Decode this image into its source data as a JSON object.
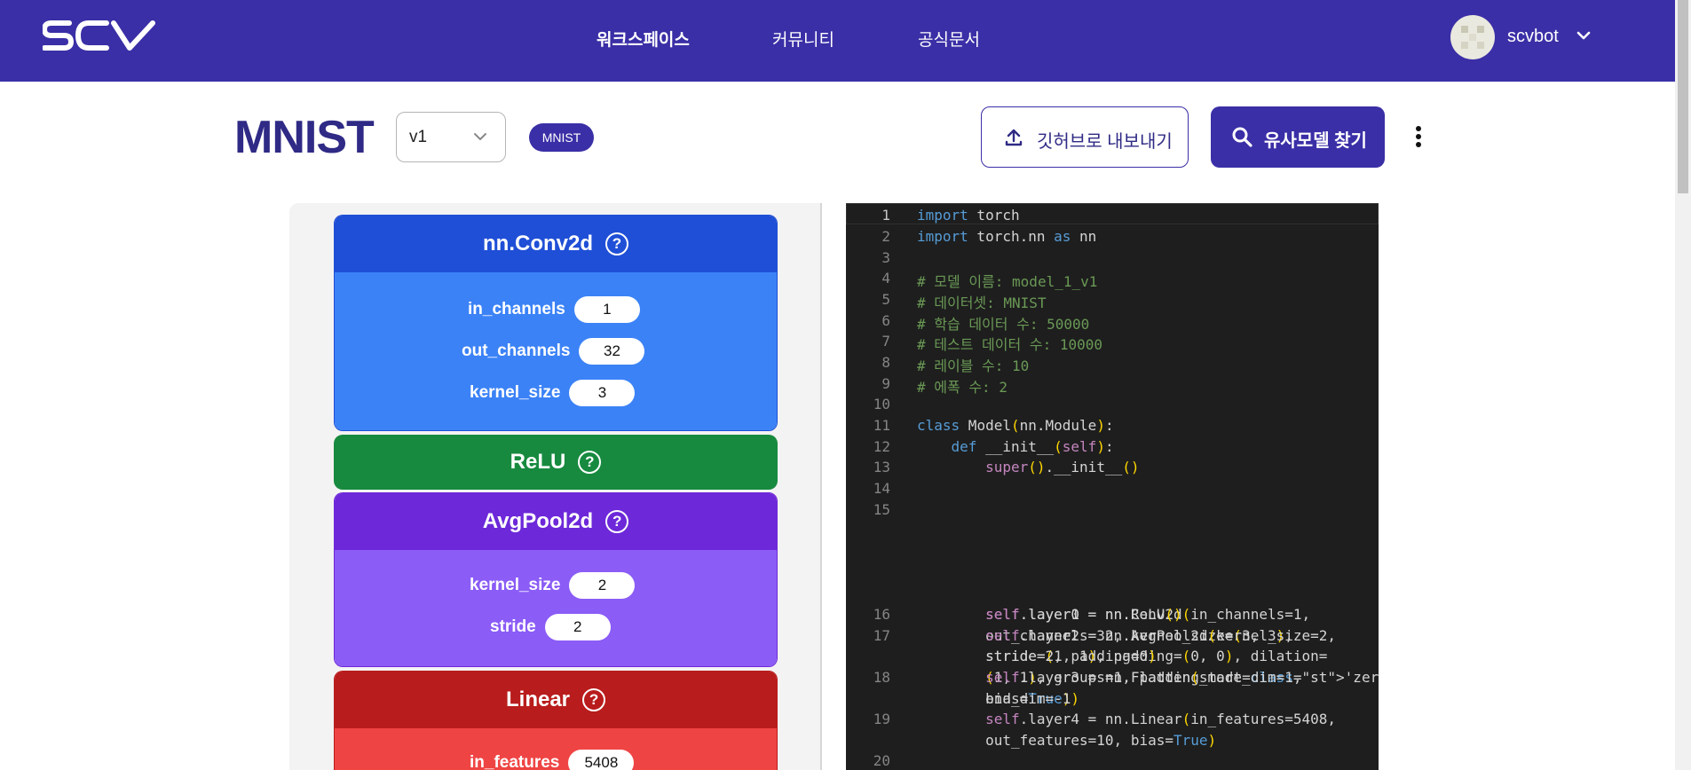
{
  "header": {
    "logo_text": "SCV",
    "nav": [
      "워크스페이스",
      "커뮤니티",
      "공식문서"
    ],
    "active_nav": "워크스페이스",
    "username": "scvbot"
  },
  "model": {
    "title": "MNIST",
    "version": "v1",
    "dataset_badge": "MNIST"
  },
  "actions": {
    "export_label": "깃허브로 내보내기",
    "find_label": "유사모델 찾기"
  },
  "layers": [
    {
      "name": "nn.Conv2d",
      "color": "#1f4fd6",
      "body_color": "#3b82f6",
      "params": [
        {
          "label": "in_channels",
          "value": "1"
        },
        {
          "label": "out_channels",
          "value": "32"
        },
        {
          "label": "kernel_size",
          "value": "3"
        }
      ]
    },
    {
      "name": "ReLU",
      "color": "#178a3f",
      "params": []
    },
    {
      "name": "AvgPool2d",
      "color": "#6d28d9",
      "body_color": "#8b5cf6",
      "params": [
        {
          "label": "kernel_size",
          "value": "2"
        },
        {
          "label": "stride",
          "value": "2"
        }
      ]
    },
    {
      "name": "Linear",
      "color": "#b91c1c",
      "body_color": "#ef4444",
      "params": [
        {
          "label": "in_features",
          "value": "5408"
        }
      ]
    }
  ],
  "code": {
    "line_numbers": [
      "1",
      "2",
      "3",
      "4",
      "5",
      "6",
      "7",
      "8",
      "9",
      "10",
      "11",
      "12",
      "13",
      "14",
      "15",
      "16",
      "17",
      "18",
      "19",
      "20"
    ],
    "lines": [
      "import torch",
      "import torch.nn as nn",
      "",
      "# 모델 이름: model_1_v1",
      "# 데이터셋: MNIST",
      "# 학습 데이터 수: 50000",
      "# 테스트 데이터 수: 10000",
      "# 레이블 수: 10",
      "# 에폭 수: 2",
      "",
      "class Model(nn.Module):",
      "    def __init__(self):",
      "        super().__init__()",
      "",
      "        self.layer0 = nn.Conv2d(in_channels=1, out_channels=32, kernel_size=(3, 3), stride=(1, 1), padding=(0, 0), dilation=(1, 1), groups=1, padding_mode='zeros', bias=True)",
      "        self.layer1 = nn.ReLU()",
      "        self.layer2 = nn.AvgPool2d(kernel_size=2, stride=2, padding=0)",
      "        self.layer3 = nn.Flatten(start_dim=1, end_dim=-1)",
      "        self.layer4 = nn.Linear(in_features=5408, out_features=10, bias=True)",
      ""
    ]
  }
}
